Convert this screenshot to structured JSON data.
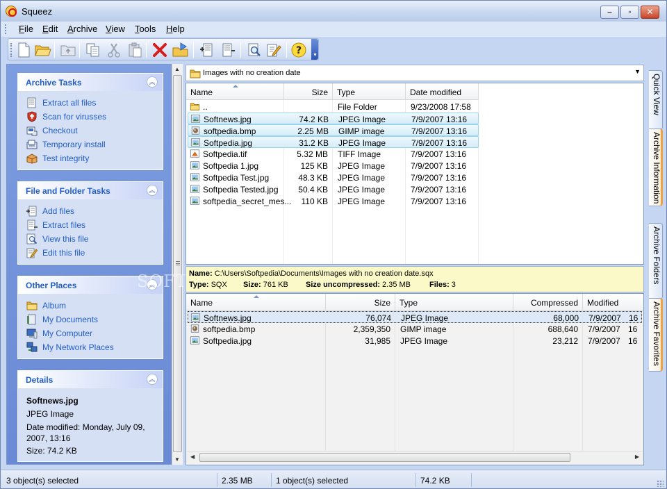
{
  "window": {
    "title": "Squeez"
  },
  "menu": [
    {
      "label": "File",
      "u": "F",
      "rest": "ile"
    },
    {
      "label": "Edit",
      "u": "E",
      "rest": "dit"
    },
    {
      "label": "Archive",
      "u": "A",
      "rest": "rchive"
    },
    {
      "label": "View",
      "u": "V",
      "rest": "iew"
    },
    {
      "label": "Tools",
      "u": "T",
      "rest": "ools"
    },
    {
      "label": "Help",
      "u": "H",
      "rest": "elp"
    }
  ],
  "toolbar": [
    {
      "icon": "new-document-icon"
    },
    {
      "icon": "open-folder-icon"
    },
    {
      "icon": "up-folder-icon"
    },
    {
      "icon": "copy-icon"
    },
    {
      "icon": "cut-icon"
    },
    {
      "icon": "paste-icon"
    },
    {
      "icon": "delete-icon"
    },
    {
      "icon": "extract-icon"
    },
    {
      "icon": "add-files-icon"
    },
    {
      "icon": "extract-files-icon"
    },
    {
      "icon": "view-icon"
    },
    {
      "icon": "edit-icon"
    },
    {
      "icon": "help-icon"
    }
  ],
  "taskpane": {
    "archive_tasks": {
      "title": "Archive Tasks",
      "items": [
        {
          "label": "Extract all files",
          "icon": "extract-all-icon"
        },
        {
          "label": "Scan for virusses",
          "icon": "shield-icon"
        },
        {
          "label": "Checkout",
          "icon": "checkout-icon"
        },
        {
          "label": "Temporary install",
          "icon": "install-icon"
        },
        {
          "label": "Test integrity",
          "icon": "test-integrity-icon"
        }
      ]
    },
    "file_folder_tasks": {
      "title": "File and Folder Tasks",
      "items": [
        {
          "label": "Add files",
          "icon": "add-files-icon"
        },
        {
          "label": "Extract files",
          "icon": "extract-files-icon"
        },
        {
          "label": "View this file",
          "icon": "view-file-icon"
        },
        {
          "label": "Edit this file",
          "icon": "edit-file-icon"
        }
      ]
    },
    "other_places": {
      "title": "Other Places",
      "items": [
        {
          "label": "Album",
          "icon": "folder-icon"
        },
        {
          "label": "My Documents",
          "icon": "documents-icon"
        },
        {
          "label": "My Computer",
          "icon": "computer-icon"
        },
        {
          "label": "My Network Places",
          "icon": "network-icon"
        }
      ]
    },
    "details": {
      "title": "Details",
      "name": "Softnews.jpg",
      "type": "JPEG Image",
      "modified_line1": "Date modified: Monday, July 09,",
      "modified_line2": "2007, 13:16",
      "size": "Size: 74.2 KB"
    }
  },
  "address": {
    "value": "Images with no creation date"
  },
  "file_list": {
    "columns": [
      "Name",
      "Size",
      "Type",
      "Date modified"
    ],
    "rows": [
      {
        "name": "..",
        "size": "",
        "type": "File Folder",
        "date": "9/23/2008 17:58",
        "icon": "folder-icon",
        "selected": false
      },
      {
        "name": "Softnews.jpg",
        "size": "74.2 KB",
        "type": "JPEG Image",
        "date": "7/9/2007 13:16",
        "icon": "image-file-icon",
        "selected": true
      },
      {
        "name": "softpedia.bmp",
        "size": "2.25 MB",
        "type": "GIMP image",
        "date": "7/9/2007 13:16",
        "icon": "gimp-file-icon",
        "selected": true
      },
      {
        "name": "Softpedia.jpg",
        "size": "31.2 KB",
        "type": "JPEG Image",
        "date": "7/9/2007 13:16",
        "icon": "image-file-icon",
        "selected": true
      },
      {
        "name": "Softpedia.tif",
        "size": "5.32 MB",
        "type": "TIFF Image",
        "date": "7/9/2007 13:16",
        "icon": "tiff-file-icon",
        "selected": false
      },
      {
        "name": "Softpedia 1.jpg",
        "size": "125 KB",
        "type": "JPEG Image",
        "date": "7/9/2007 13:16",
        "icon": "image-file-icon",
        "selected": false
      },
      {
        "name": "Softpedia Test.jpg",
        "size": "48.3 KB",
        "type": "JPEG Image",
        "date": "7/9/2007 13:16",
        "icon": "image-file-icon",
        "selected": false
      },
      {
        "name": "Softpedia Tested.jpg",
        "size": "50.4 KB",
        "type": "JPEG Image",
        "date": "7/9/2007 13:16",
        "icon": "image-file-icon",
        "selected": false
      },
      {
        "name": "softpedia_secret_mes...",
        "size": "110 KB",
        "type": "JPEG Image",
        "date": "7/9/2007 13:16",
        "icon": "image-file-icon",
        "selected": false
      }
    ]
  },
  "archive_info": {
    "name_label": "Name:",
    "name_value": "C:\\Users\\Softpedia\\Documents\\Images with no creation date.sqx",
    "type_label": "Type:",
    "type_value": "SQX",
    "size_label": "Size:",
    "size_value": "761 KB",
    "uncompressed_label": "Size uncompressed:",
    "uncompressed_value": "2.35 MB",
    "files_label": "Files:",
    "files_value": "3"
  },
  "archive_list": {
    "columns": [
      "Name",
      "Size",
      "Type",
      "Compressed",
      "Modified"
    ],
    "rows": [
      {
        "name": "Softnews.jpg",
        "size": "76,074",
        "type": "JPEG Image",
        "compressed": "68,000",
        "modified": "7/9/2007",
        "modified_time": "16",
        "icon": "image-file-icon",
        "selected": true
      },
      {
        "name": "softpedia.bmp",
        "size": "2,359,350",
        "type": "GIMP image",
        "compressed": "688,640",
        "modified": "7/9/2007",
        "modified_time": "16",
        "icon": "gimp-file-icon",
        "selected": false
      },
      {
        "name": "Softpedia.jpg",
        "size": "31,985",
        "type": "JPEG Image",
        "compressed": "23,212",
        "modified": "7/9/2007",
        "modified_time": "16",
        "icon": "image-file-icon",
        "selected": false
      }
    ]
  },
  "right_tabs": [
    {
      "label": "Quick View",
      "active": false
    },
    {
      "label": "Archive Information",
      "active": true
    },
    {
      "label": "Archive Folders",
      "active": false
    },
    {
      "label": "Archive Favorites",
      "active": true
    }
  ],
  "status": {
    "selected_left": "3 object(s) selected",
    "size_left": "2.35 MB",
    "selected_right": "1 object(s) selected",
    "size_right": "74.2 KB"
  },
  "watermark": "SOFTP",
  "colors": {
    "task_link": "#215dc6",
    "pane_blue": "#7c9de0",
    "selection": "#d3edf8"
  }
}
